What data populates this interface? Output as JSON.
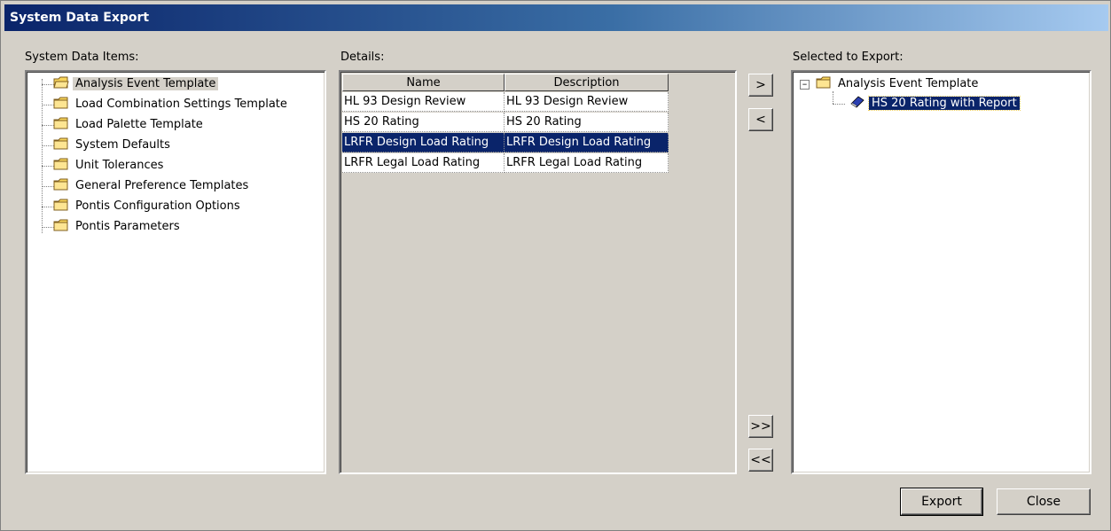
{
  "window": {
    "title": "System Data Export"
  },
  "left_panel": {
    "label": "System Data Items:",
    "items": [
      "Analysis Event Template",
      "Load Combination Settings Template",
      "Load Palette Template",
      "System Defaults",
      "Unit Tolerances",
      "General Preference Templates",
      "Pontis Configuration Options",
      "Pontis Parameters"
    ],
    "selected_index": 0
  },
  "details": {
    "label": "Details:",
    "columns": [
      "Name",
      "Description"
    ],
    "rows": [
      [
        "HL 93 Design Review",
        "HL 93 Design Review"
      ],
      [
        "HS 20 Rating",
        "HS 20 Rating"
      ],
      [
        "LRFR Design Load Rating",
        "LRFR Design Load Rating"
      ],
      [
        "LRFR Legal Load Rating",
        "LRFR Legal Load Rating"
      ]
    ],
    "selected_row": 2
  },
  "move_buttons": {
    "add": ">",
    "remove": "<",
    "add_all": ">>",
    "remove_all": "<<"
  },
  "right_panel": {
    "label": "Selected to Export:",
    "expander": "⊟",
    "root": "Analysis Event Template",
    "child": "HS 20 Rating with Report"
  },
  "footer": {
    "export_label": "Export",
    "close_label": "Close"
  },
  "colors": {
    "selection": "#0a246a",
    "dialog_bg": "#d4d0c8",
    "folder": "#f7d45a"
  }
}
